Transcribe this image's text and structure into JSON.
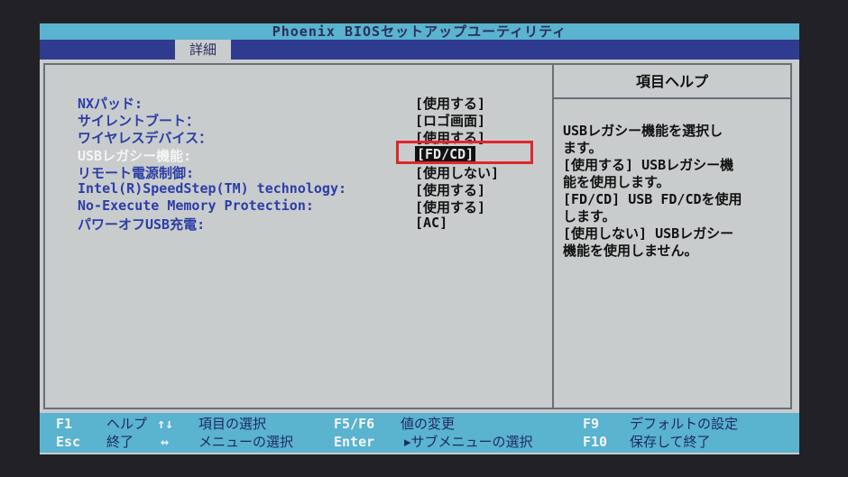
{
  "title": "Phoenix BIOSセットアップユーティリティ",
  "menu": {
    "active_tab": "詳細"
  },
  "settings": [
    {
      "label": "NXパッド:",
      "value": "[使用する]"
    },
    {
      "label": "サイレントブート：",
      "value": "[ロゴ画面]"
    },
    {
      "label": "ワイヤレスデバイス：",
      "value": "[使用する]"
    },
    {
      "label": "USBレガシー機能:",
      "value": "[FD/CD]"
    },
    {
      "label": "リモート電源制御:",
      "value": "[使用しない]"
    },
    {
      "label": "Intel(R)SpeedStep(TM) technology:",
      "value": "[使用する]"
    },
    {
      "label": "No-Execute Memory Protection:",
      "value": "[使用する]"
    },
    {
      "label": "パワーオフUSB充電:",
      "value": "[AC]"
    }
  ],
  "selected_index": 3,
  "help": {
    "title": "項目ヘルプ",
    "lines": [
      "USBレガシー機能を選択し",
      "ます。",
      "[使用する] USBレガシー機",
      "能を使用します。",
      "[FD/CD] USB FD/CDを使用",
      "します。",
      "[使用しない] USBレガシー",
      "機能を使用しません。"
    ]
  },
  "footer": {
    "f1": {
      "key": "F1",
      "desc": "ヘルプ"
    },
    "arrows_ud": {
      "key": "↑↓",
      "desc": "項目の選択"
    },
    "f5f6": {
      "key": "F5/F6",
      "desc": "値の変更"
    },
    "f9": {
      "key": "F9",
      "desc": "デフォルトの設定"
    },
    "esc": {
      "key": "Esc",
      "desc": "終了"
    },
    "arrows_lr": {
      "key": "↔",
      "desc": "メニューの選択"
    },
    "enter": {
      "key": "Enter",
      "desc": "▸サブメニューの選択"
    },
    "f10": {
      "key": "F10",
      "desc": "保存して終了"
    }
  },
  "colors": {
    "screen_bg": "#c9cccd",
    "title_bar": "#5ab3cf",
    "menu_bar": "#2f3b8f",
    "label_blue": "#2c3ea6",
    "highlight_white": "#f4f4f4",
    "annotation_red": "#e0262d"
  }
}
